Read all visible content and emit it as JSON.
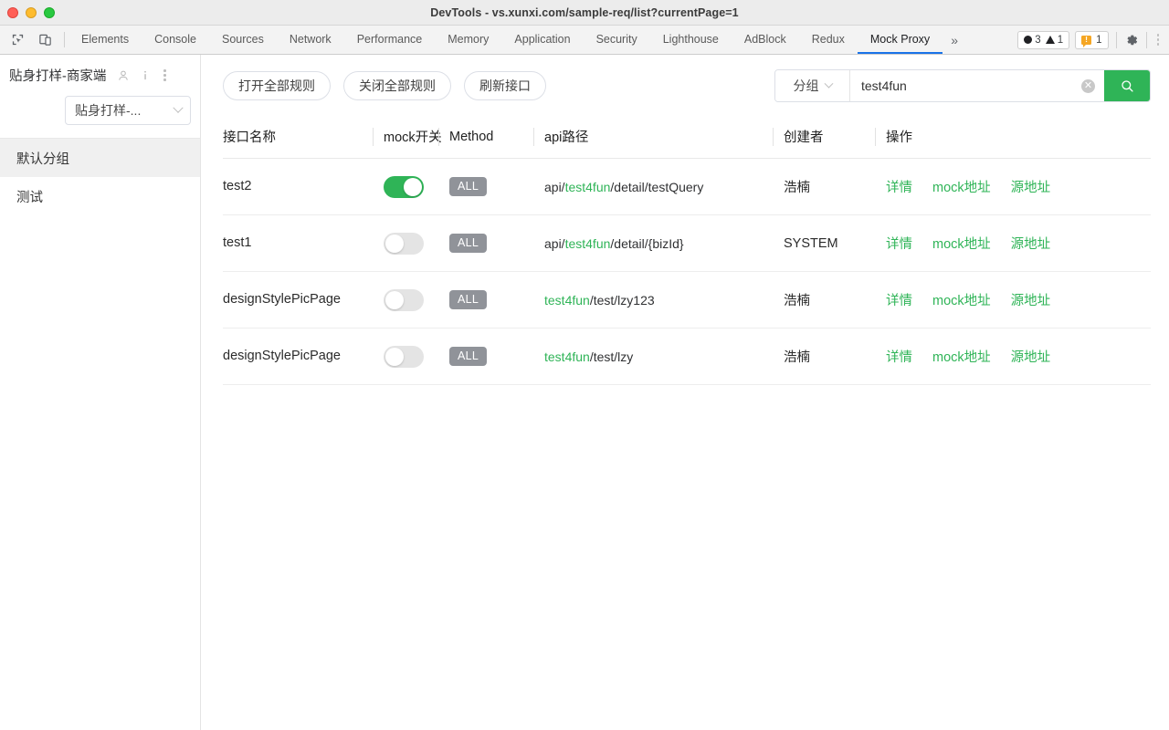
{
  "window": {
    "title": "DevTools - vs.xunxi.com/sample-req/list?currentPage=1",
    "traffic_lights": [
      "close-red",
      "minimize-yellow",
      "zoom-green"
    ]
  },
  "devtools": {
    "left_icons": [
      "inspect-element-icon",
      "device-toolbar-icon"
    ],
    "tabs": [
      {
        "label": "Elements",
        "active": false
      },
      {
        "label": "Console",
        "active": false
      },
      {
        "label": "Sources",
        "active": false
      },
      {
        "label": "Network",
        "active": false
      },
      {
        "label": "Performance",
        "active": false
      },
      {
        "label": "Memory",
        "active": false
      },
      {
        "label": "Application",
        "active": false
      },
      {
        "label": "Security",
        "active": false
      },
      {
        "label": "Lighthouse",
        "active": false
      },
      {
        "label": "AdBlock",
        "active": false
      },
      {
        "label": "Redux",
        "active": false
      },
      {
        "label": "Mock Proxy",
        "active": true
      }
    ],
    "overflow_label": "»",
    "errors_count": "3",
    "warnings_count": "1",
    "issues_count": "1",
    "active_tab_underline_color": "#1a73e8"
  },
  "sidebar": {
    "title": "贴身打样-商家端",
    "header_icons": [
      "person-icon",
      "info-icon",
      "kebab-menu-icon"
    ],
    "project_select_value": "贴身打样-...",
    "items": [
      {
        "label": "默认分组",
        "selected": true
      },
      {
        "label": "测试",
        "selected": false
      }
    ]
  },
  "toolbar": {
    "open_all_label": "打开全部规则",
    "close_all_label": "关闭全部规则",
    "refresh_label": "刷新接口"
  },
  "search": {
    "scope_label": "分组",
    "value": "test4fun",
    "placeholder": "",
    "clear_icon": "clear-circle-icon",
    "search_icon": "search-icon",
    "button_color": "#2fb457"
  },
  "table": {
    "headers": {
      "name": "接口名称",
      "mock_switch": "mock开关",
      "method": "Method",
      "api_path": "api路径",
      "creator": "创建者",
      "operations": "操作"
    },
    "ops_labels": {
      "detail": "详情",
      "mock_url": "mock地址",
      "source_url": "源地址"
    },
    "highlight_term": "test4fun",
    "rows": [
      {
        "name": "test2",
        "mock_on": true,
        "method": "ALL",
        "path_parts": [
          {
            "text": "api/",
            "highlight": false
          },
          {
            "text": "test4fun",
            "highlight": true
          },
          {
            "text": "/detail/testQuery",
            "highlight": false
          }
        ],
        "creator": "浩楠"
      },
      {
        "name": "test1",
        "mock_on": false,
        "method": "ALL",
        "path_parts": [
          {
            "text": "api/",
            "highlight": false
          },
          {
            "text": "test4fun",
            "highlight": true
          },
          {
            "text": "/detail/{bizId}",
            "highlight": false
          }
        ],
        "creator": "SYSTEM"
      },
      {
        "name": "designStylePicPage",
        "mock_on": false,
        "method": "ALL",
        "path_parts": [
          {
            "text": "test4fun",
            "highlight": true
          },
          {
            "text": "/test/lzy123",
            "highlight": false
          }
        ],
        "creator": "浩楠"
      },
      {
        "name": "designStylePicPage",
        "mock_on": false,
        "method": "ALL",
        "path_parts": [
          {
            "text": "test4fun",
            "highlight": true
          },
          {
            "text": "/test/lzy",
            "highlight": false
          }
        ],
        "creator": "浩楠"
      }
    ]
  },
  "colors": {
    "accent_green": "#2fb457",
    "method_gray": "#909399",
    "tab_active_blue": "#1a73e8",
    "issue_orange": "#f5a623"
  }
}
